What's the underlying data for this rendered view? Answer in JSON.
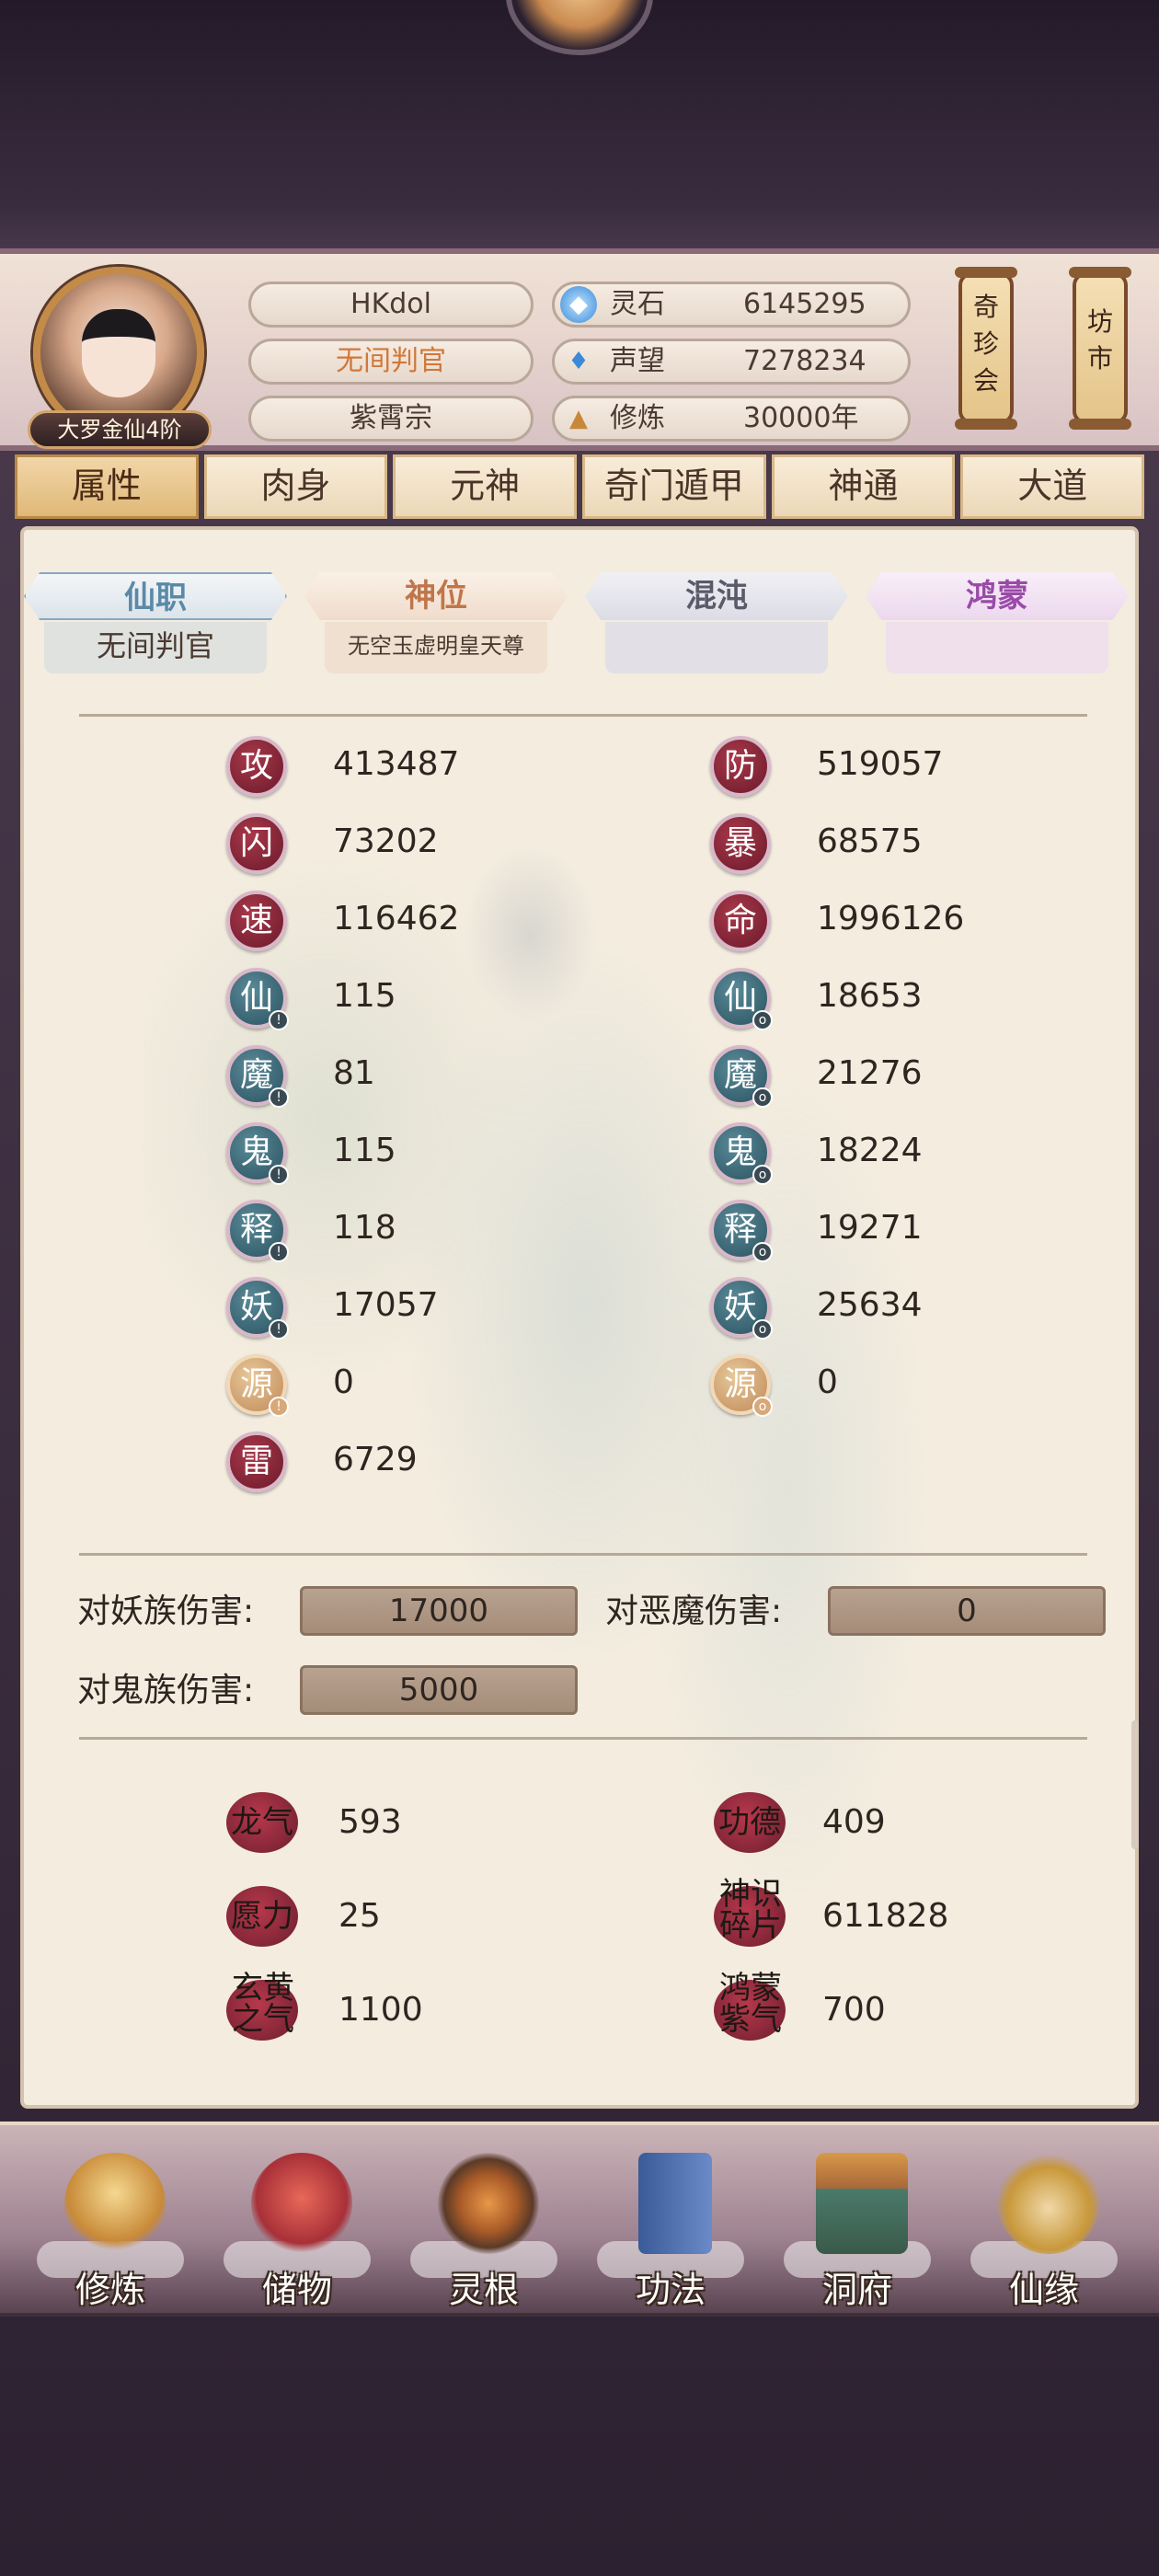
{
  "header": {
    "player_name": "HKdol",
    "title": "无间判官",
    "sect": "紫霄宗",
    "rank": "大罗金仙4阶",
    "resources": [
      {
        "icon": "spirit-stone-icon",
        "label": "灵石",
        "value": "6145295"
      },
      {
        "icon": "prestige-icon",
        "label": "声望",
        "value": "7278234"
      },
      {
        "icon": "cultivation-icon",
        "label": "修炼",
        "value": "30000年"
      }
    ],
    "right_buttons": [
      "奇珍会",
      "坊市"
    ]
  },
  "tabs": [
    "属性",
    "肉身",
    "元神",
    "奇门遁甲",
    "神通",
    "大道"
  ],
  "active_tab": "属性",
  "ranks": [
    {
      "label": "仙职",
      "value": "无间判官",
      "color": "#5a8aa8"
    },
    {
      "label": "神位",
      "value": "无空玉虚明皇天尊",
      "color": "#c0764a"
    },
    {
      "label": "混沌",
      "value": "",
      "color": "#5a5a6a"
    },
    {
      "label": "鸿蒙",
      "value": "",
      "color": "#9a4aa8"
    }
  ],
  "stats_left": [
    {
      "char": "攻",
      "value": "413487",
      "style": "red",
      "badge": ""
    },
    {
      "char": "闪",
      "value": "73202",
      "style": "red",
      "badge": ""
    },
    {
      "char": "速",
      "value": "116462",
      "style": "red",
      "badge": ""
    },
    {
      "char": "仙",
      "value": "115",
      "style": "teal",
      "badge": "!"
    },
    {
      "char": "魔",
      "value": "81",
      "style": "teal",
      "badge": "!"
    },
    {
      "char": "鬼",
      "value": "115",
      "style": "teal",
      "badge": "!"
    },
    {
      "char": "释",
      "value": "118",
      "style": "teal",
      "badge": "!"
    },
    {
      "char": "妖",
      "value": "17057",
      "style": "teal",
      "badge": "!"
    },
    {
      "char": "源",
      "value": "0",
      "style": "gold",
      "badge": "!"
    },
    {
      "char": "雷",
      "value": "6729",
      "style": "red",
      "badge": ""
    }
  ],
  "stats_right": [
    {
      "char": "防",
      "value": "519057",
      "style": "red",
      "badge": ""
    },
    {
      "char": "暴",
      "value": "68575",
      "style": "red",
      "badge": ""
    },
    {
      "char": "命",
      "value": "1996126",
      "style": "red",
      "badge": ""
    },
    {
      "char": "仙",
      "value": "18653",
      "style": "teal",
      "badge": "o"
    },
    {
      "char": "魔",
      "value": "21276",
      "style": "teal",
      "badge": "o"
    },
    {
      "char": "鬼",
      "value": "18224",
      "style": "teal",
      "badge": "o"
    },
    {
      "char": "释",
      "value": "19271",
      "style": "teal",
      "badge": "o"
    },
    {
      "char": "妖",
      "value": "25634",
      "style": "teal",
      "badge": "o"
    },
    {
      "char": "源",
      "value": "0",
      "style": "gold",
      "badge": "o"
    }
  ],
  "damage": [
    {
      "label": "对妖族伤害:",
      "value": "17000"
    },
    {
      "label": "对恶魔伤害:",
      "value": "0"
    },
    {
      "label": "对鬼族伤害:",
      "value": "5000"
    }
  ],
  "misc_left": [
    {
      "label": "龙气",
      "value": "593"
    },
    {
      "label": "愿力",
      "value": "25"
    },
    {
      "label": "玄黄之气",
      "value": "1100"
    }
  ],
  "misc_right": [
    {
      "label": "功德",
      "value": "409"
    },
    {
      "label": "神识碎片",
      "value": "611828"
    },
    {
      "label": "鸿蒙紫气",
      "value": "700"
    }
  ],
  "bottom_nav": [
    "修炼",
    "储物",
    "灵根",
    "功法",
    "洞府",
    "仙缘"
  ],
  "colors": {
    "panel_bg": "#f3ecdf",
    "stat_red": "#8a2a3a",
    "stat_teal": "#3e6a78",
    "stat_gold": "#d8a878",
    "title_orange": "#d0783a"
  }
}
